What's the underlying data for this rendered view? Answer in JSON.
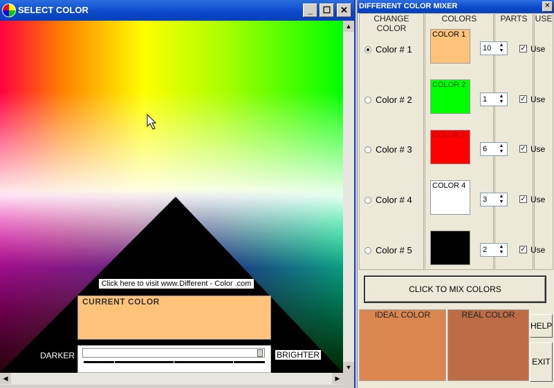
{
  "select_window": {
    "title": "SELECT COLOR",
    "buttons": {
      "minimize": "_",
      "maximize": "☐",
      "close": "✕"
    },
    "visit_link": "Click here to visit   www.Different - Color .com",
    "current_color_label": "CURRENT COLOR",
    "current_color": "#ffc47a",
    "darker_label": "DARKER",
    "brighter_label": "BRIGHTER"
  },
  "mixer_window": {
    "title": "DIFFERENT COLOR MIXER",
    "close": "✕",
    "headers": {
      "change_color": "CHANGE COLOR",
      "colors": "COLORS",
      "parts": "PARTS",
      "use": "USE"
    },
    "rows": [
      {
        "radio_label": "Color # 1",
        "selected": true,
        "swatch_label": "COLOR 1",
        "swatch_color": "#ffc47a",
        "label_color": "#000000",
        "parts": "10",
        "use_label": "Use",
        "use": true
      },
      {
        "radio_label": "Color # 2",
        "selected": false,
        "swatch_label": "COLOR 2",
        "swatch_color": "#00ff00",
        "label_color": "#006600",
        "parts": "1",
        "use_label": "Use",
        "use": true
      },
      {
        "radio_label": "Color # 3",
        "selected": false,
        "swatch_label": "COLOR 3",
        "swatch_color": "#ff0000",
        "label_color": "#aa0000",
        "parts": "6",
        "use_label": "Use",
        "use": true
      },
      {
        "radio_label": "Color # 4",
        "selected": false,
        "swatch_label": "COLOR 4",
        "swatch_color": "#ffffff",
        "label_color": "#000000",
        "parts": "3",
        "use_label": "Use",
        "use": true
      },
      {
        "radio_label": "Color # 5",
        "selected": false,
        "swatch_label": "",
        "swatch_color": "#000000",
        "label_color": "#000000",
        "parts": "2",
        "use_label": "Use",
        "use": true
      }
    ],
    "mix_button": "CLICK TO MIX COLORS",
    "ideal_label": "IDEAL COLOR",
    "ideal_color": "#d9864f",
    "real_label": "REAL COLOR",
    "real_color": "#bc6d45",
    "help_button": "HELP",
    "exit_button": "EXIT"
  }
}
